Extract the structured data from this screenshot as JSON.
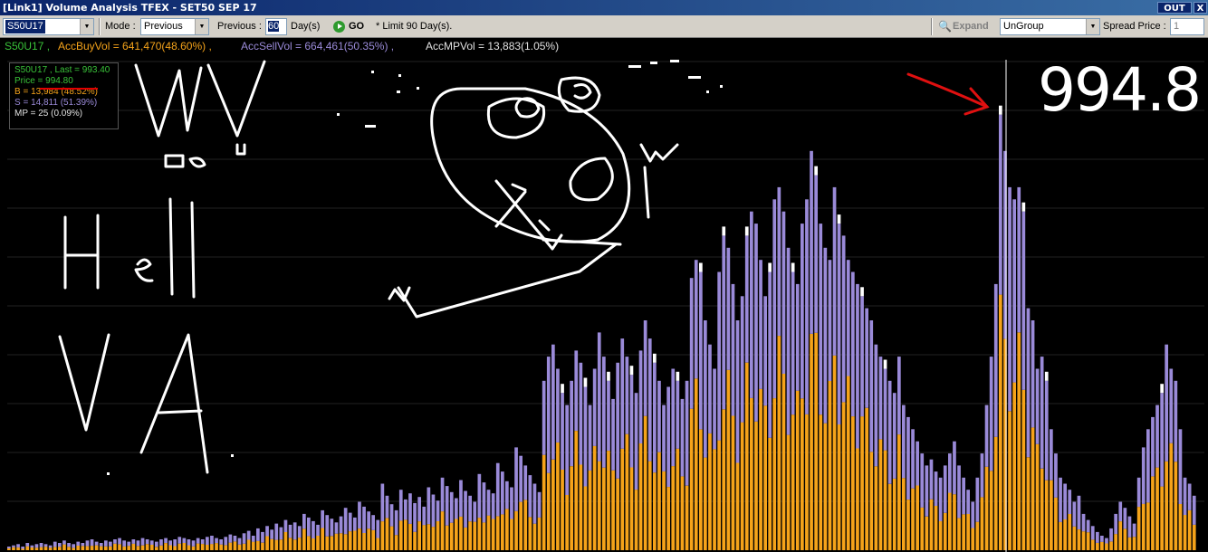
{
  "window": {
    "title": "[Link1] Volume Analysis TFEX - SET50 SEP 17",
    "out_label": "OUT",
    "close_label": "X"
  },
  "toolbar": {
    "symbol": "S50U17",
    "mode_label": "Mode :",
    "mode_value": "Previous",
    "previous_label": "Previous :",
    "previous_value": "60",
    "days_label": "Day(s)",
    "go_label": "GO",
    "limit_note": "* Limit 90 Day(s).",
    "expand_label": "Expand",
    "group_value": "UnGroup",
    "spread_label": "Spread Price :",
    "spread_value": "1"
  },
  "summary": {
    "symbol": "S50U17 ,",
    "buy": "AccBuyVol  = 641,470(48.60%) ,",
    "sell": "AccSellVol  = 664,461(50.35%) ,",
    "mp": "AccMPVol = 13,883(1.05%)"
  },
  "infobox": {
    "line1": "S50U17 , Last = 993.40",
    "line2": "Price = 994.80",
    "line3": "B = 13,984 (48.52%)",
    "line4": "S = 14,811 (51.39%)",
    "line5": "MP = 25 (0.09%)"
  },
  "annotation": {
    "price": "994.8"
  },
  "colors": {
    "buy": "#f5a31a",
    "sell": "#9a8ad8",
    "mp": "#ffffff",
    "background": "#000000",
    "grid": "#222222",
    "cursor": "#ffffff",
    "arrow": "#e01010"
  },
  "chart_data": {
    "type": "bar",
    "stacked": true,
    "series": [
      {
        "name": "B",
        "color": "#f5a31a"
      },
      {
        "name": "S",
        "color": "#9a8ad8"
      },
      {
        "name": "MP",
        "color": "#ffffff"
      }
    ],
    "cursor_price": 994.8,
    "profile_totals": [
      3,
      4,
      5,
      3,
      6,
      4,
      5,
      6,
      5,
      4,
      7,
      6,
      8,
      6,
      5,
      7,
      6,
      8,
      9,
      7,
      6,
      8,
      7,
      9,
      10,
      8,
      7,
      9,
      8,
      10,
      9,
      8,
      7,
      9,
      10,
      8,
      9,
      11,
      10,
      9,
      8,
      10,
      9,
      11,
      12,
      10,
      9,
      11,
      13,
      12,
      10,
      14,
      16,
      12,
      18,
      15,
      20,
      17,
      22,
      19,
      25,
      21,
      23,
      20,
      30,
      27,
      24,
      21,
      33,
      29,
      26,
      23,
      28,
      35,
      31,
      27,
      40,
      36,
      32,
      29,
      25,
      55,
      45,
      38,
      33,
      50,
      42,
      47,
      39,
      44,
      36,
      52,
      46,
      41,
      60,
      53,
      48,
      43,
      58,
      49,
      45,
      40,
      63,
      56,
      50,
      47,
      72,
      65,
      57,
      52,
      85,
      78,
      70,
      62,
      55,
      48,
      140,
      160,
      170,
      150,
      130,
      120,
      140,
      165,
      155,
      135,
      120,
      150,
      180,
      160,
      140,
      125,
      155,
      175,
      160,
      145,
      130,
      165,
      190,
      175,
      155,
      140,
      120,
      135,
      150,
      140,
      125,
      140,
      225,
      240,
      230,
      190,
      170,
      150,
      230,
      260,
      250,
      220,
      190,
      210,
      260,
      280,
      270,
      240,
      210,
      230,
      290,
      300,
      280,
      250,
      230,
      220,
      270,
      290,
      330,
      310,
      270,
      250,
      240,
      300,
      270,
      260,
      240,
      230,
      220,
      210,
      200,
      190,
      170,
      160,
      150,
      140,
      130,
      160,
      120,
      110,
      100,
      90,
      80,
      70,
      75,
      65,
      60,
      70,
      80,
      90,
      70,
      60,
      50,
      40,
      60,
      80,
      120,
      160,
      220,
      360,
      330,
      300,
      290,
      300,
      280,
      200,
      190,
      150,
      160,
      140,
      100,
      80,
      60,
      55,
      50,
      40,
      45,
      30,
      25,
      20,
      15,
      12,
      10,
      18,
      30,
      40,
      35,
      28,
      22,
      60,
      85,
      100,
      110,
      120,
      130,
      170,
      150,
      140,
      100,
      60,
      55,
      45
    ]
  }
}
